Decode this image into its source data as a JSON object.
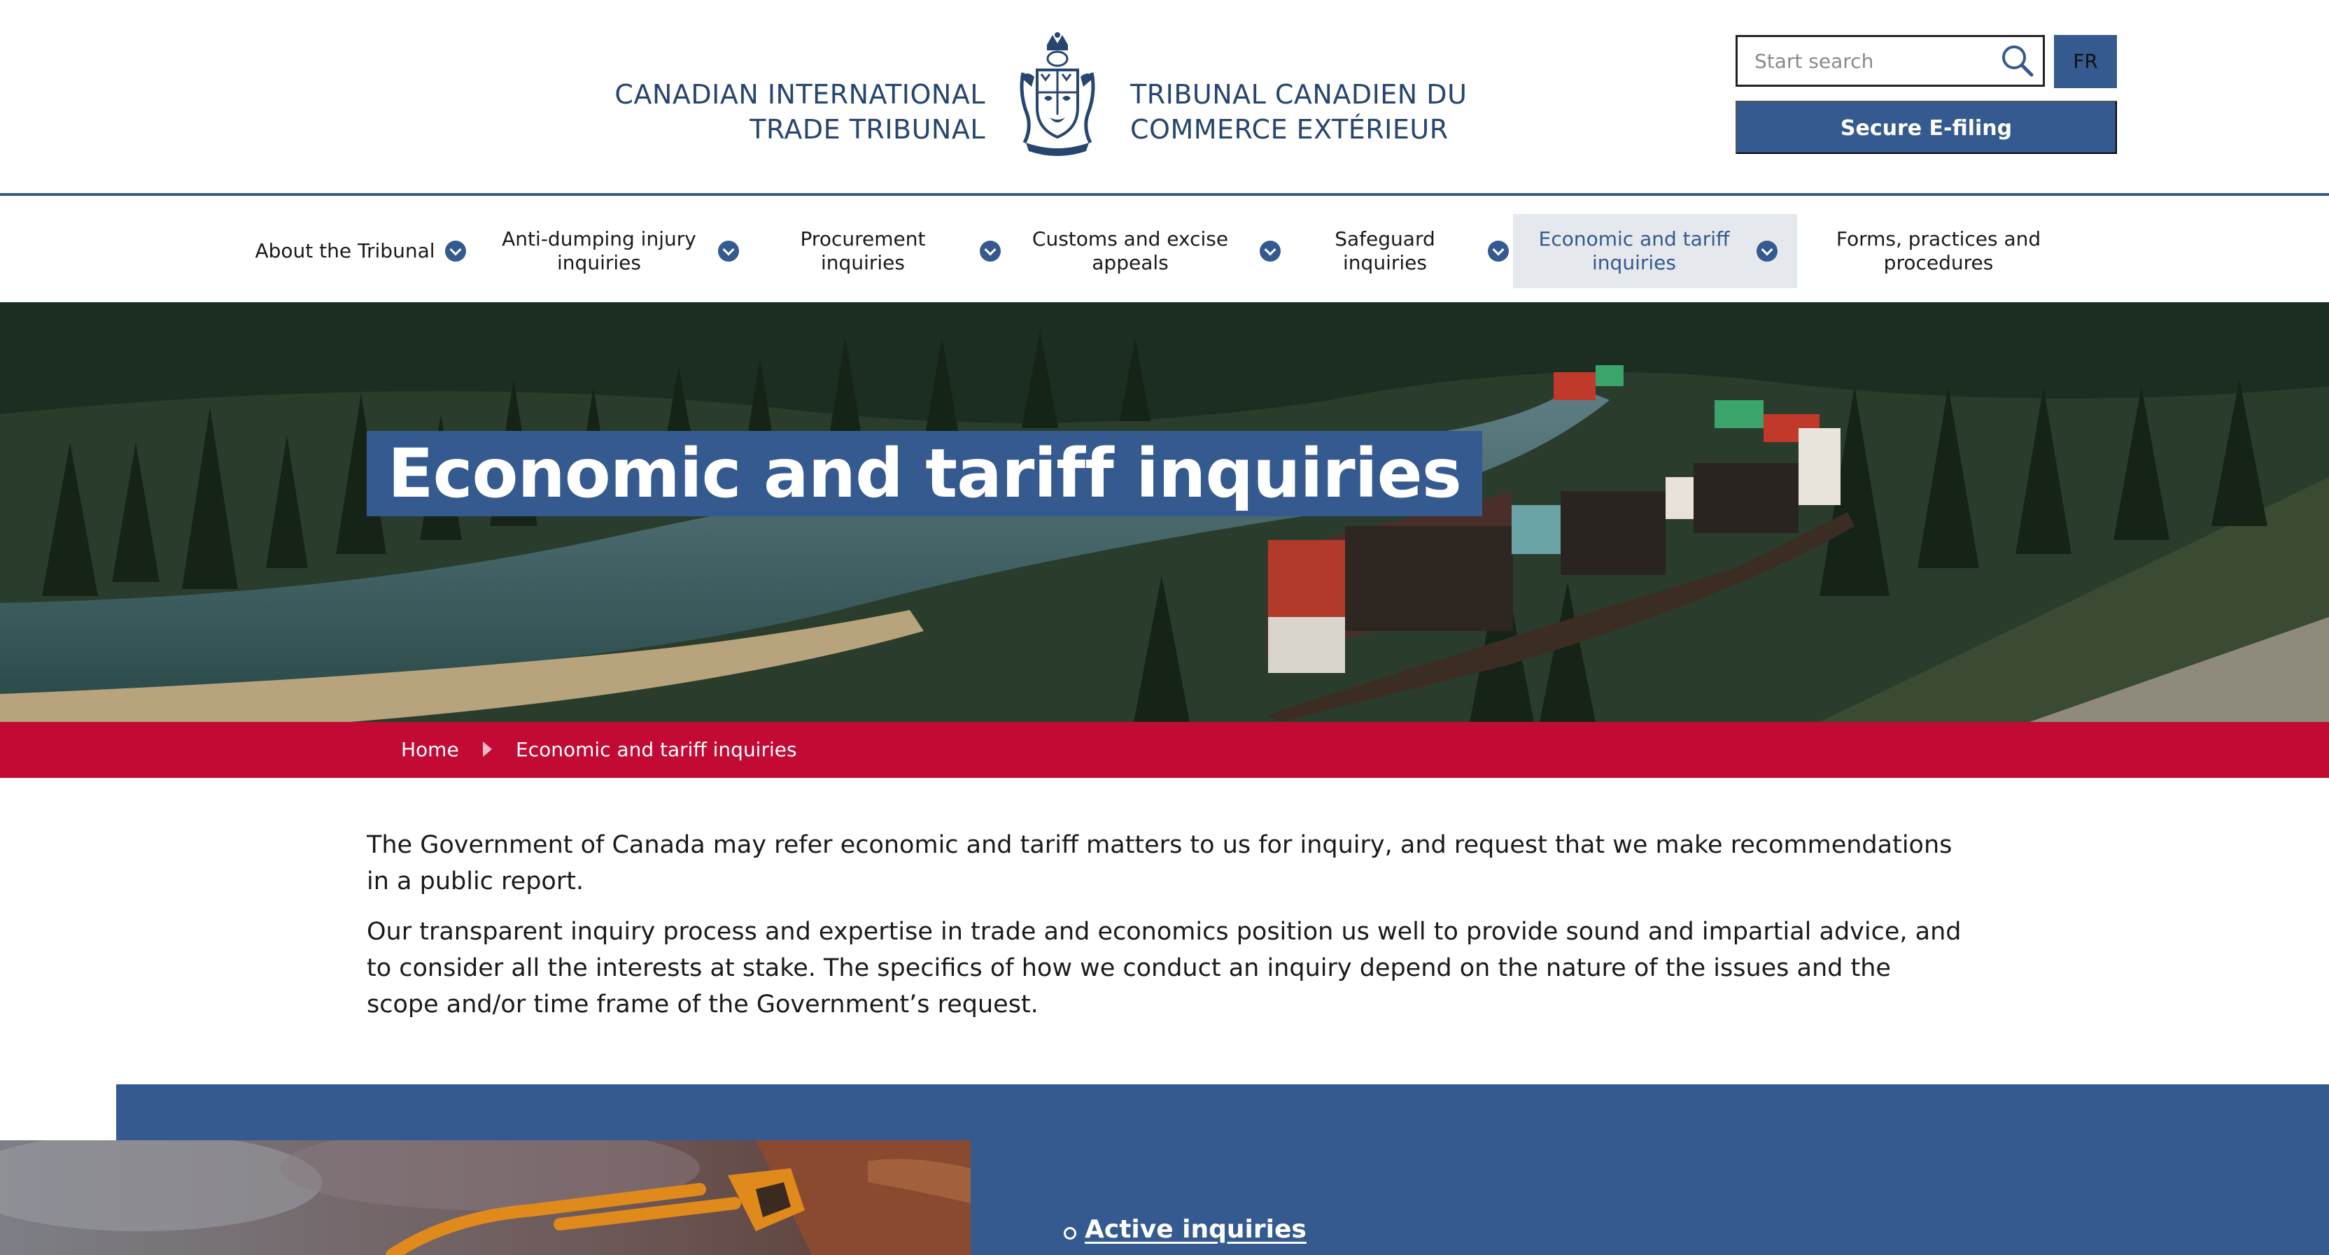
{
  "header": {
    "brand_en_line1": "CANADIAN INTERNATIONAL",
    "brand_en_line2": "TRADE TRIBUNAL",
    "brand_fr_line1": "TRIBUNAL CANADIEN DU",
    "brand_fr_line2": "COMMERCE EXTÉRIEUR",
    "crest_icon": "coat-of-arms-icon",
    "search_placeholder": "Start search",
    "search_icon": "search-icon",
    "lang_label": "FR",
    "efiling_label": "Secure E-filing"
  },
  "nav": {
    "items": [
      {
        "label": "About the Tribunal",
        "has_dropdown": true
      },
      {
        "label": "Anti-dumping injury inquiries",
        "has_dropdown": true
      },
      {
        "label": "Procurement inquiries",
        "has_dropdown": true
      },
      {
        "label": "Customs and excise appeals",
        "has_dropdown": true
      },
      {
        "label": "Safeguard inquiries",
        "has_dropdown": true
      },
      {
        "label": "Economic and tariff inquiries",
        "has_dropdown": true,
        "active": true
      },
      {
        "label": "Forms, practices and procedures",
        "has_dropdown": false
      }
    ]
  },
  "hero": {
    "title": "Economic and tariff inquiries"
  },
  "breadcrumb": {
    "home": "Home",
    "current": "Economic and tariff inquiries"
  },
  "intro": {
    "paragraph1": "The Government of Canada may refer economic and tariff matters to us for inquiry, and request that we make recommendations in a public report.",
    "paragraph2": "Our transparent inquiry process and expertise in trade and economics position us well to provide sound and impartial advice, and to consider all the interests at stake. The specifics of how we conduct an inquiry depend on the nature of the issues and the scope and/or time frame of the Government’s request."
  },
  "feature": {
    "links": [
      {
        "label": "Active inquiries"
      }
    ]
  },
  "colors": {
    "brand_blue": "#345a8f",
    "dark_blue": "#26456f",
    "breadcrumb_red": "#c20a34",
    "nav_active_bg": "#e5e8ec"
  }
}
